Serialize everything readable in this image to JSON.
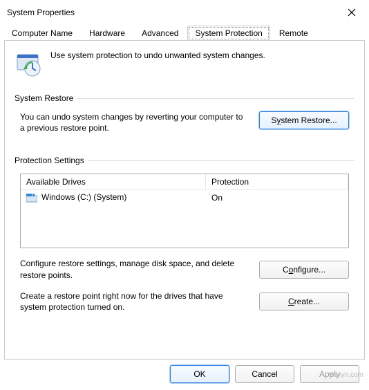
{
  "window": {
    "title": "System Properties"
  },
  "tabs": {
    "computer_name": "Computer Name",
    "hardware": "Hardware",
    "advanced": "Advanced",
    "system_protection": "System Protection",
    "remote": "Remote"
  },
  "header_text": "Use system protection to undo unwanted system changes.",
  "restore_group": {
    "label": "System Restore",
    "text": "You can undo system changes by reverting your computer to a previous restore point.",
    "button_pre": "S",
    "button_u": "y",
    "button_post": "stem Restore..."
  },
  "protection_group": {
    "label": "Protection Settings",
    "col_drive": "Available Drives",
    "col_prot": "Protection",
    "row_drive": "Windows (C:) (System)",
    "row_prot": "On",
    "configure_text": "Configure restore settings, manage disk space, and delete restore points.",
    "configure_pre": "C",
    "configure_u": "o",
    "configure_post": "nfigure...",
    "create_text": "Create a restore point right now for the drives that have system protection turned on.",
    "create_pre": "",
    "create_u": "C",
    "create_post": "reate..."
  },
  "dialog": {
    "ok": "OK",
    "cancel": "Cancel",
    "apply": "Apply"
  },
  "watermark": "wsxyn.com"
}
